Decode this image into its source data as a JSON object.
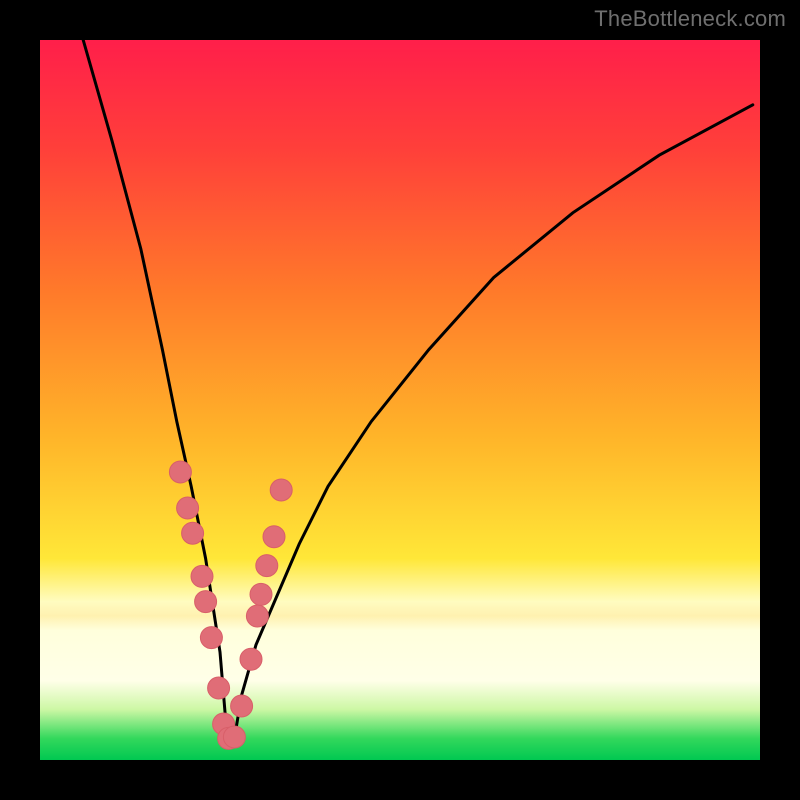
{
  "watermark": "TheBottleneck.com",
  "colors": {
    "frame": "#000000",
    "curve": "#000000",
    "marker_fill": "#e06d77",
    "marker_stroke": "#d85f69",
    "gradient_top": "#ff1f4a",
    "gradient_bottom": "#00c851"
  },
  "chart_data": {
    "type": "line",
    "title": "",
    "xlabel": "",
    "ylabel": "",
    "xlim": [
      0,
      100
    ],
    "ylim": [
      0,
      100
    ],
    "grid": false,
    "legend": false,
    "note": "V-shaped bottleneck curve; minimum near x≈26. Values are read off the figure extent (0–100 on both axes).",
    "series": [
      {
        "name": "curve",
        "x": [
          6,
          10,
          14,
          17,
          19,
          21,
          23,
          25,
          26,
          27,
          28,
          30,
          33,
          36,
          40,
          46,
          54,
          63,
          74,
          86,
          99
        ],
        "y": [
          100,
          86,
          71,
          57,
          47,
          38,
          28,
          15,
          3,
          3,
          9,
          16,
          23,
          30,
          38,
          47,
          57,
          67,
          76,
          84,
          91
        ]
      }
    ],
    "markers": {
      "name": "highlighted-points",
      "x": [
        19.5,
        20.5,
        21.2,
        22.5,
        23.0,
        23.8,
        24.8,
        25.5,
        26.2,
        27.0,
        28.0,
        29.3,
        30.2,
        30.7,
        31.5,
        32.5,
        33.5
      ],
      "y": [
        40.0,
        35.0,
        31.5,
        25.5,
        22.0,
        17.0,
        10.0,
        5.0,
        3.0,
        3.2,
        7.5,
        14.0,
        20.0,
        23.0,
        27.0,
        31.0,
        37.5
      ]
    }
  }
}
